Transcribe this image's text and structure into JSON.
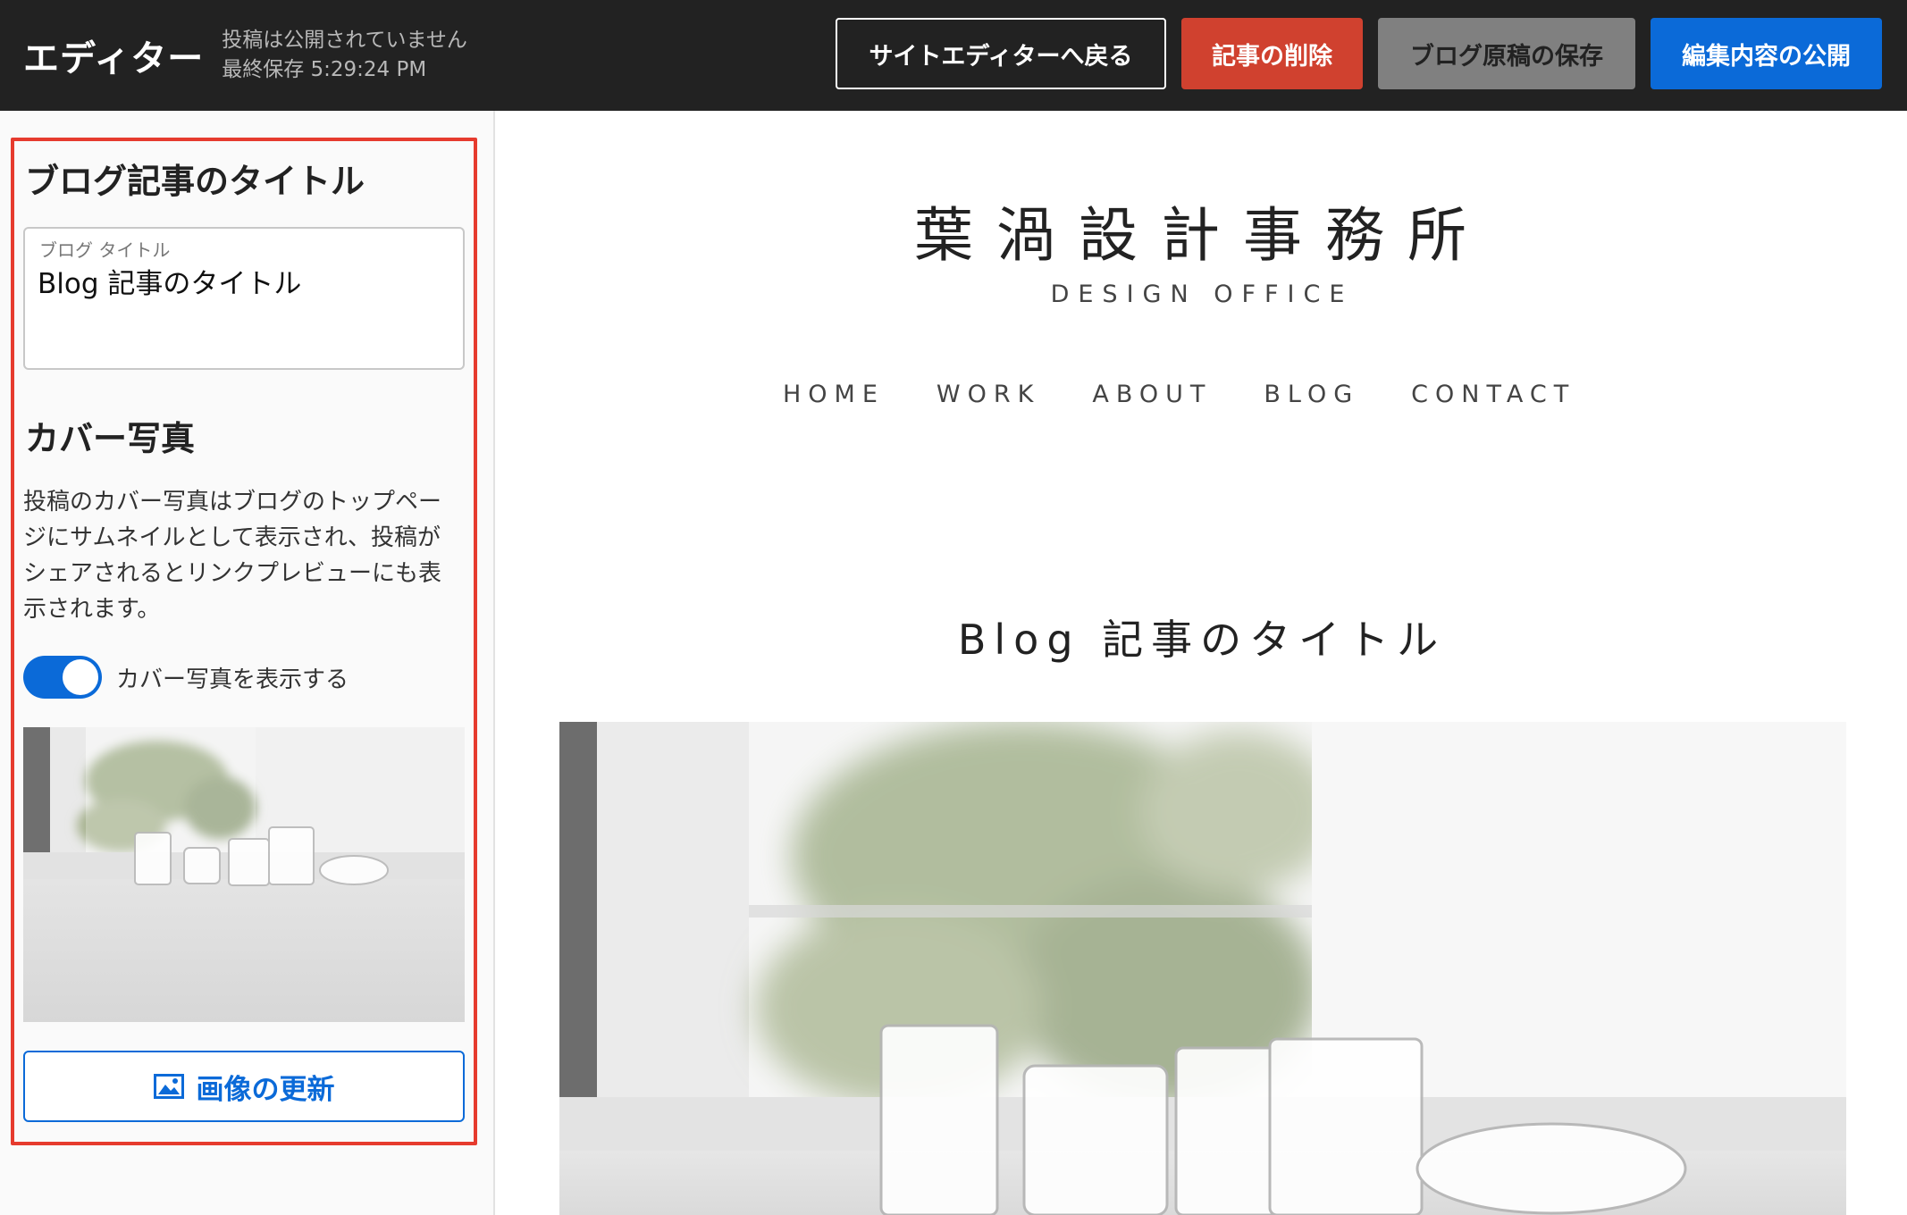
{
  "topbar": {
    "title": "エディター",
    "status_line1": "投稿は公開されていません",
    "status_line2": "最終保存 5:29:24 PM",
    "back_label": "サイトエディターへ戻る",
    "delete_label": "記事の削除",
    "save_label": "ブログ原稿の保存",
    "publish_label": "編集内容の公開"
  },
  "sidebar": {
    "title_heading": "ブログ記事のタイトル",
    "title_field_label": "ブログ タイトル",
    "title_field_value": "Blog 記事のタイトル",
    "cover_heading": "カバー写真",
    "cover_description": "投稿のカバー写真はブログのトップページにサムネイルとして表示され、投稿がシェアされるとリンクプレビューにも表示されます。",
    "show_cover_toggle": true,
    "show_cover_label": "カバー写真を表示する",
    "update_image_label": "画像の更新"
  },
  "preview": {
    "site_name": "葉渦設計事務所",
    "site_sub": "DESIGN OFFICE",
    "nav": [
      "HOME",
      "WORK",
      "ABOUT",
      "BLOG",
      "CONTACT"
    ],
    "post_title": "Blog 記事のタイトル"
  },
  "colors": {
    "topbar_bg": "#222222",
    "primary": "#0b6ad8",
    "danger": "#d0412f",
    "secondary": "#808080",
    "highlight": "#e63b2e"
  },
  "icons": {
    "update_image": "image-icon"
  }
}
